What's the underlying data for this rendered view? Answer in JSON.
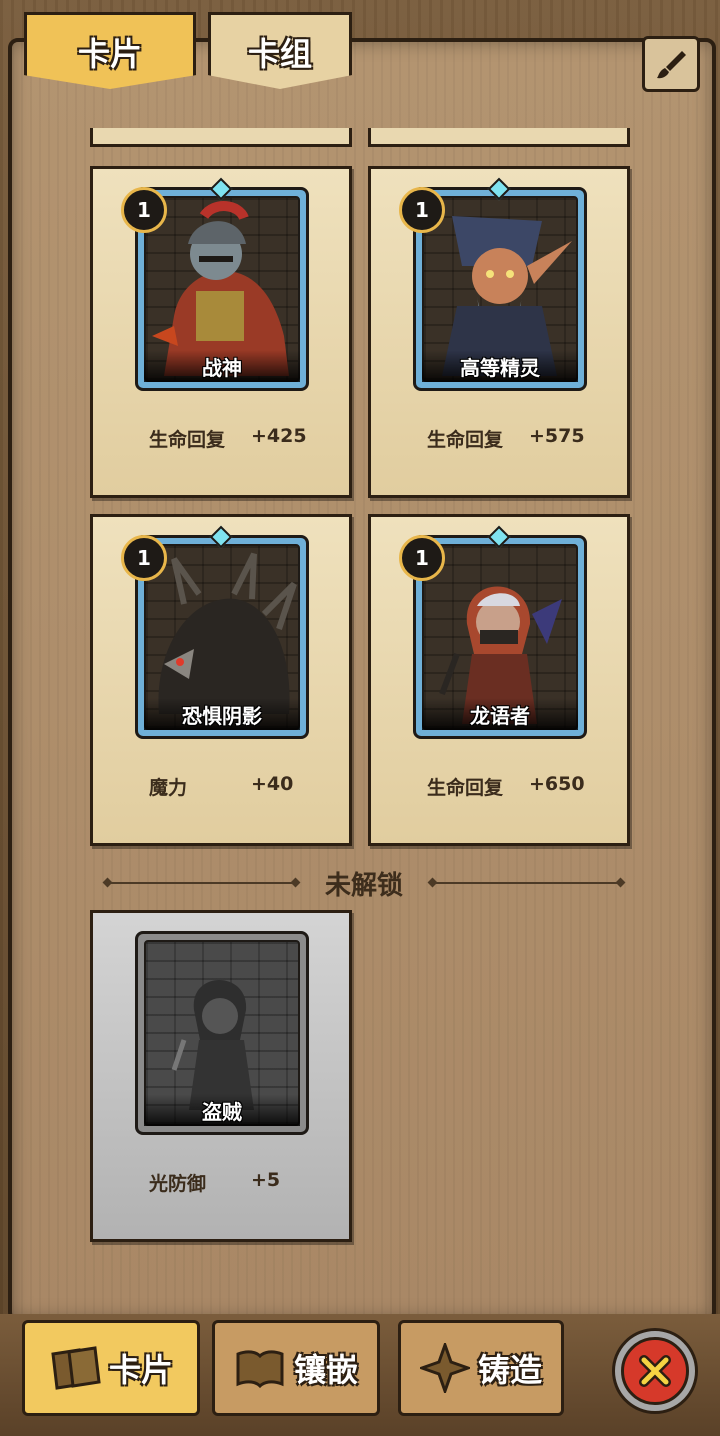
{
  "top_tabs": [
    {
      "label": "卡片",
      "active": true
    },
    {
      "label": "卡组",
      "active": false
    }
  ],
  "edit_icon": "brush-icon",
  "cards": [
    {
      "level": "1",
      "name": "战神",
      "stat_name": "生命回复",
      "stat_value": "+425",
      "locked": false
    },
    {
      "level": "1",
      "name": "高等精灵",
      "stat_name": "生命回复",
      "stat_value": "+575",
      "locked": false
    },
    {
      "level": "1",
      "name": "恐惧阴影",
      "stat_name": "魔力",
      "stat_value": "+40",
      "locked": false
    },
    {
      "level": "1",
      "name": "龙语者",
      "stat_name": "生命回复",
      "stat_value": "+650",
      "locked": false
    }
  ],
  "locked_section": {
    "label": "未解锁",
    "cards": [
      {
        "name": "盗贼",
        "stat_name": "光防御",
        "stat_value": "+5",
        "locked": true
      }
    ]
  },
  "bottom_tabs": [
    {
      "label": "卡片",
      "icon": "card-icon",
      "active": true
    },
    {
      "label": "镶嵌",
      "icon": "book-icon",
      "active": false
    },
    {
      "label": "铸造",
      "icon": "forge-icon",
      "active": false
    }
  ],
  "close_icon": "close-icon",
  "colors": {
    "accent": "#f0c257",
    "close": "#d6392a",
    "card_bg": "#efe1bd",
    "frame_blue": "#6fb0d8"
  }
}
